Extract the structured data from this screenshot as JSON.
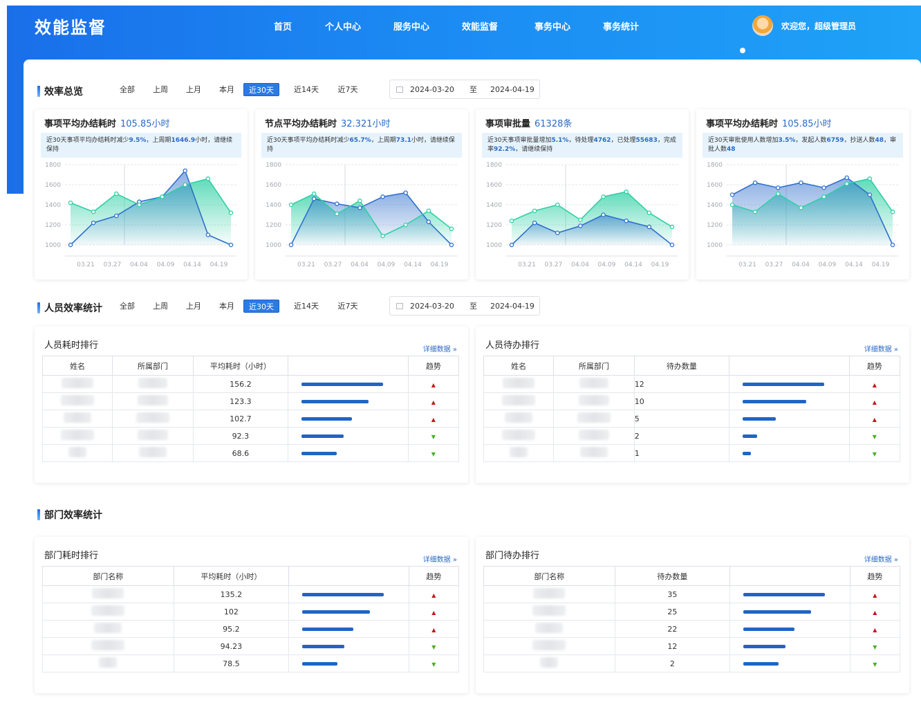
{
  "header": {
    "title": "效能监督",
    "nav": [
      "首页",
      "个人中心",
      "服务中心",
      "效能监督",
      "事务中心",
      "事务统计"
    ],
    "welcome": "欢迎您，超级管理员"
  },
  "filters": {
    "options": [
      "全部",
      "上周",
      "上月",
      "本月",
      "近30天",
      "近14天",
      "近7天"
    ],
    "active": "近30天",
    "start": "2024-03-20",
    "to": "至",
    "end": "2024-04-19"
  },
  "overview": {
    "title": "效率总览",
    "cards": [
      {
        "title": "事项平均办结耗时",
        "value": "105.85小时",
        "note": [
          [
            "近30天事项平均办结耗时减少",
            ""
          ],
          [
            "9.5%",
            "b"
          ],
          [
            "，上周期",
            ""
          ],
          [
            "1646.9",
            "b"
          ],
          [
            "小时，请继续保持",
            ""
          ]
        ]
      },
      {
        "title": "节点平均办结耗时",
        "value": "32.321小时",
        "note": [
          [
            "近30天事项平均办结耗时减少",
            ""
          ],
          [
            "65.7%",
            "b"
          ],
          [
            "，上周期",
            ""
          ],
          [
            "73.1",
            "b"
          ],
          [
            "小时，请继续保持",
            ""
          ]
        ]
      },
      {
        "title": "事项审批量",
        "value": "61328条",
        "note": [
          [
            "近30天事项审批量增加",
            ""
          ],
          [
            "5.1%",
            "b"
          ],
          [
            "，待处理",
            ""
          ],
          [
            "4762",
            "b"
          ],
          [
            "，已处理",
            ""
          ],
          [
            "55683",
            "b"
          ],
          [
            "，完成率",
            ""
          ],
          [
            "92.2%",
            "b"
          ],
          [
            "，请继续保持",
            ""
          ]
        ]
      },
      {
        "title": "事项平均办结耗时",
        "value": "105.85小时",
        "note": [
          [
            "近30天审批使用人数增加",
            ""
          ],
          [
            "3.5%",
            "b"
          ],
          [
            "，发起人数",
            ""
          ],
          [
            "6759",
            "b"
          ],
          [
            "，抄送人数",
            ""
          ],
          [
            "48",
            "b"
          ],
          [
            "，审批人数",
            ""
          ],
          [
            "48",
            "b"
          ]
        ]
      }
    ]
  },
  "chart_data": [
    {
      "type": "area",
      "x": [
        "03.21",
        "03.27",
        "04.04",
        "04.09",
        "04.14",
        "04.19"
      ],
      "ylim": [
        1000,
        1800
      ],
      "yticks": [
        1000,
        1200,
        1400,
        1600,
        1800
      ],
      "series": [
        {
          "values": [
            1000,
            1220,
            1290,
            1430,
            1480,
            1740,
            1100,
            1000
          ],
          "color": "#2f6fcc"
        },
        {
          "values": [
            1420,
            1330,
            1510,
            1400,
            1480,
            1600,
            1660,
            1320
          ],
          "color": "#2ed0a4"
        }
      ]
    },
    {
      "type": "area",
      "x": [
        "03.21",
        "03.27",
        "04.04",
        "04.09",
        "04.14",
        "04.19"
      ],
      "ylim": [
        1000,
        1800
      ],
      "yticks": [
        1000,
        1200,
        1400,
        1600,
        1800
      ],
      "series": [
        {
          "values": [
            1000,
            1460,
            1410,
            1370,
            1480,
            1520,
            1230,
            1000
          ],
          "color": "#2f6fcc"
        },
        {
          "values": [
            1400,
            1510,
            1310,
            1440,
            1090,
            1200,
            1340,
            1160
          ],
          "color": "#2ed0a4"
        }
      ]
    },
    {
      "type": "area",
      "x": [
        "03.21",
        "03.27",
        "04.04",
        "04.09",
        "04.14",
        "04.19"
      ],
      "ylim": [
        1000,
        1800
      ],
      "yticks": [
        1000,
        1200,
        1400,
        1600,
        1800
      ],
      "series": [
        {
          "values": [
            1000,
            1220,
            1120,
            1190,
            1300,
            1240,
            1180,
            1000
          ],
          "color": "#2f6fcc"
        },
        {
          "values": [
            1240,
            1340,
            1400,
            1250,
            1480,
            1530,
            1320,
            1180
          ],
          "color": "#2ed0a4"
        }
      ]
    },
    {
      "type": "area",
      "x": [
        "03.21",
        "03.27",
        "04.04",
        "04.09",
        "04.14",
        "04.19"
      ],
      "ylim": [
        1000,
        1800
      ],
      "yticks": [
        1000,
        1200,
        1400,
        1600,
        1800
      ],
      "series": [
        {
          "values": [
            1500,
            1620,
            1570,
            1620,
            1570,
            1670,
            1500,
            1000
          ],
          "color": "#2f6fcc"
        },
        {
          "values": [
            1400,
            1330,
            1510,
            1370,
            1480,
            1610,
            1660,
            1330
          ],
          "color": "#2ed0a4"
        }
      ]
    }
  ],
  "people": {
    "title": "人员效率统计",
    "time": {
      "title": "人员耗时排行",
      "more": "详细数据",
      "cols": [
        "姓名",
        "所属部门",
        "平均耗时（小时）",
        "",
        "趋势"
      ],
      "rows": [
        {
          "value": "156.2",
          "pct": 1.0,
          "trend": "up"
        },
        {
          "value": "123.3",
          "pct": 0.82,
          "trend": "up"
        },
        {
          "value": "102.7",
          "pct": 0.62,
          "trend": "up"
        },
        {
          "value": "92.3",
          "pct": 0.52,
          "trend": "down"
        },
        {
          "value": "68.6",
          "pct": 0.43,
          "trend": "down"
        }
      ]
    },
    "todo": {
      "title": "人员待办排行",
      "more": "详细数据",
      "cols": [
        "姓名",
        "所属部门",
        "待办数量",
        "",
        "趋势"
      ],
      "rows": [
        {
          "value": "12",
          "pct": 1.0,
          "trend": "up"
        },
        {
          "value": "10",
          "pct": 0.78,
          "trend": "up"
        },
        {
          "value": "5",
          "pct": 0.41,
          "trend": "up"
        },
        {
          "value": "2",
          "pct": 0.18,
          "trend": "down"
        },
        {
          "value": "1",
          "pct": 0.1,
          "trend": "down"
        }
      ]
    }
  },
  "dept": {
    "title": "部门效率统计",
    "time": {
      "title": "部门耗时排行",
      "more": "详细数据",
      "cols": [
        "部门名称",
        "平均耗时（小时）",
        "",
        "趋势"
      ],
      "rows": [
        {
          "value": "135.2",
          "pct": 1.0,
          "trend": "up"
        },
        {
          "value": "102",
          "pct": 0.83,
          "trend": "up"
        },
        {
          "value": "95.2",
          "pct": 0.63,
          "trend": "up"
        },
        {
          "value": "94.23",
          "pct": 0.52,
          "trend": "down"
        },
        {
          "value": "78.5",
          "pct": 0.43,
          "trend": "down"
        }
      ]
    },
    "todo": {
      "title": "部门待办排行",
      "more": "详细数据",
      "cols": [
        "部门名称",
        "待办数量",
        "",
        "趋势"
      ],
      "rows": [
        {
          "value": "35",
          "pct": 1.0,
          "trend": "up"
        },
        {
          "value": "25",
          "pct": 0.83,
          "trend": "up"
        },
        {
          "value": "22",
          "pct": 0.63,
          "trend": "up"
        },
        {
          "value": "12",
          "pct": 0.52,
          "trend": "down"
        },
        {
          "value": "2",
          "pct": 0.43,
          "trend": "down"
        }
      ]
    }
  }
}
